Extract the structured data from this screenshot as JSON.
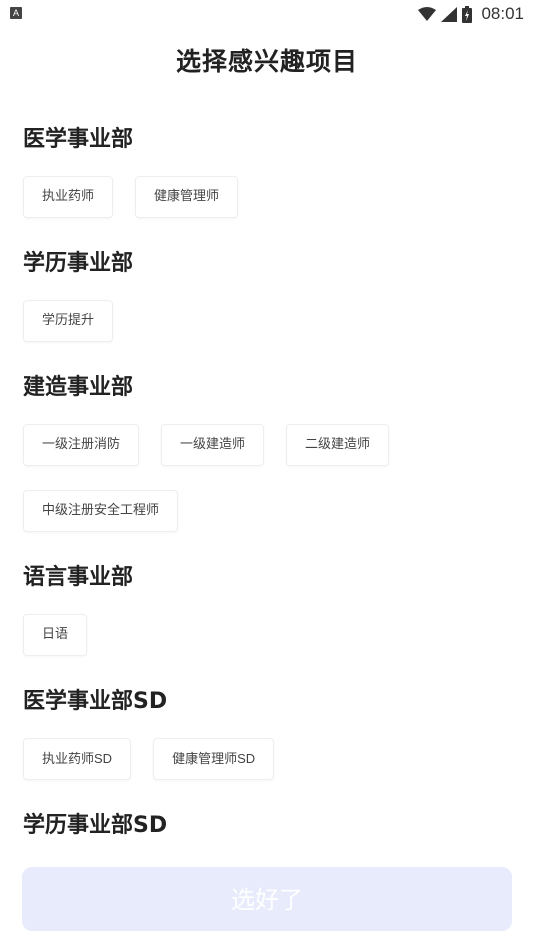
{
  "status_bar": {
    "app_icon_letter": "A",
    "time": "08:01",
    "icons": [
      "wifi-icon",
      "signal-icon",
      "battery-icon"
    ]
  },
  "page_title": "选择感兴趣项目",
  "sections": [
    {
      "title": "医学事业部",
      "tags": [
        "执业药师",
        "健康管理师"
      ]
    },
    {
      "title": "学历事业部",
      "tags": [
        "学历提升"
      ]
    },
    {
      "title": "建造事业部",
      "tags": [
        "一级注册消防",
        "一级建造师",
        "二级建造师",
        "中级注册安全工程师"
      ]
    },
    {
      "title": "语言事业部",
      "tags": [
        "日语"
      ]
    },
    {
      "title": "医学事业部SD",
      "tags": [
        "执业药师SD",
        "健康管理师SD"
      ]
    },
    {
      "title": "学历事业部SD",
      "tags": []
    }
  ],
  "confirm_button": {
    "label": "选好了",
    "state": "disabled"
  },
  "colors": {
    "button_bg": "#e7ebfb",
    "button_text": "#ffffff",
    "tag_border": "#eeeeee",
    "title_text": "#222222"
  }
}
